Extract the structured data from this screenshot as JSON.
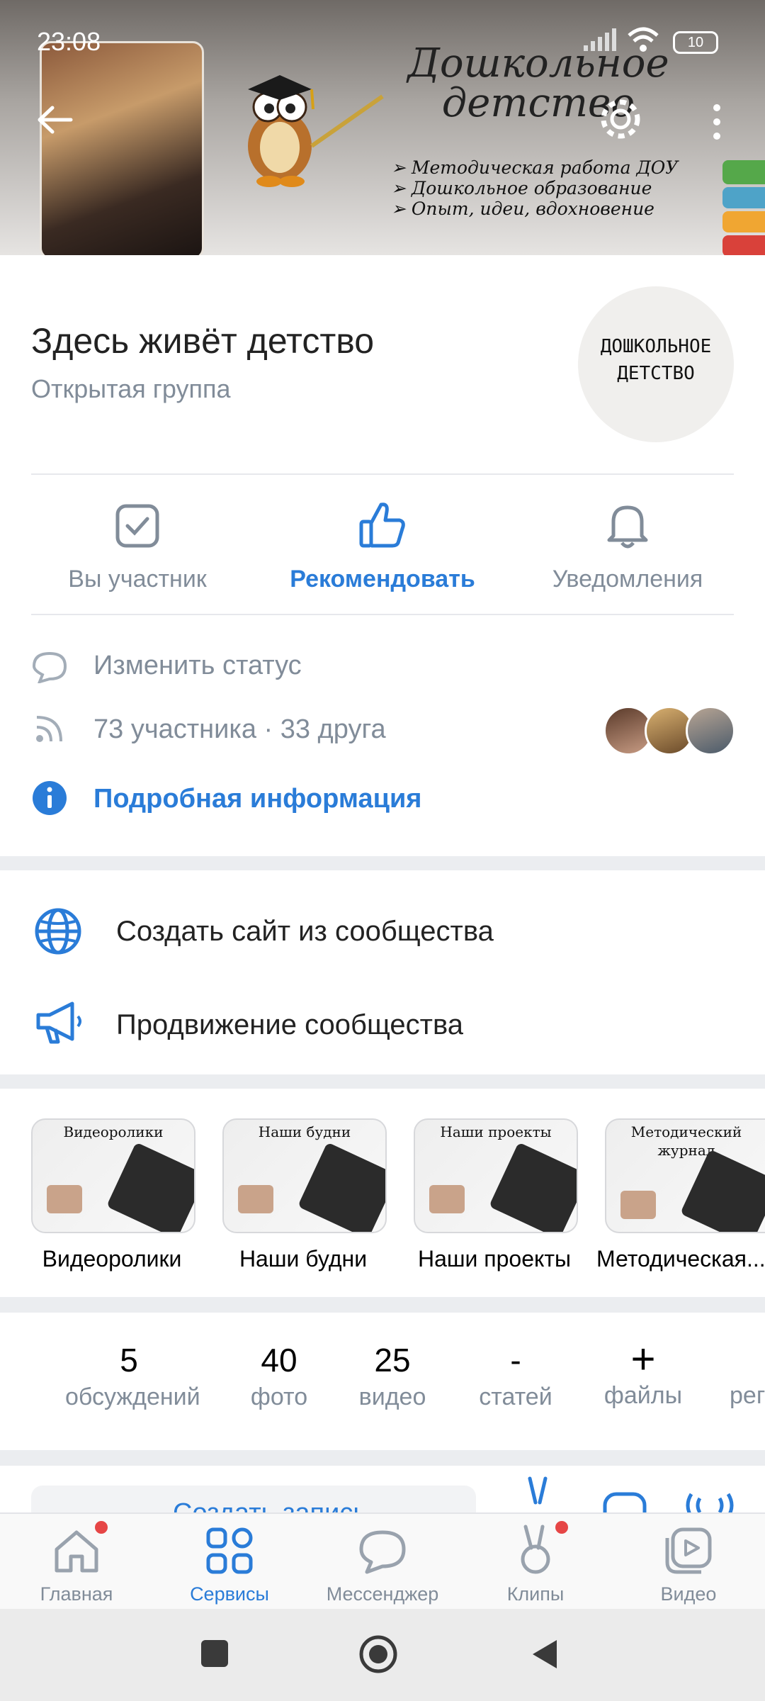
{
  "status_bar": {
    "time": "23:08",
    "battery": "10"
  },
  "cover": {
    "title_line1": "Дошкольное",
    "title_line2": "детство",
    "bullets": [
      "Методическая работа ДОУ",
      "Дошкольное образование",
      "Опыт, идеи, вдохновение"
    ],
    "back_icon": "arrow-left-icon",
    "settings_icon": "gear-icon",
    "more_icon": "more-vertical-icon"
  },
  "group": {
    "name": "Здесь живёт детство",
    "type": "Открытая группа",
    "avatar_text_line1": "ДОШКОЛЬНОЕ",
    "avatar_text_line2": "ДЕТСТВО"
  },
  "actions": [
    {
      "label": "Вы участник",
      "icon": "checkbox-icon",
      "active": false
    },
    {
      "label": "Рекомендовать",
      "icon": "thumbs-up-icon",
      "active": true
    },
    {
      "label": "Уведомления",
      "icon": "bell-icon",
      "active": false
    }
  ],
  "info": {
    "status": "Изменить статус",
    "members": "73 участника · 33 друга",
    "details": "Подробная информация"
  },
  "links": {
    "create_site": "Создать сайт из сообщества",
    "promote": "Продвижение сообщества"
  },
  "albums": [
    {
      "caption": "Видеоролики",
      "label": "Видеоролики"
    },
    {
      "caption": "Наши будни",
      "label": "Наши будни"
    },
    {
      "caption": "Наши проекты",
      "label": "Наши проекты"
    },
    {
      "caption": "Методический журнал",
      "label": "Методическая..."
    }
  ],
  "stats": [
    {
      "value": "5",
      "label": "обсуждений"
    },
    {
      "value": "40",
      "label": "фото"
    },
    {
      "value": "25",
      "label": "видео"
    },
    {
      "value": "-",
      "label": "статей"
    },
    {
      "value": "+",
      "label": "файлы"
    },
    {
      "value": "",
      "label": "рег"
    }
  ],
  "post": {
    "create_label": "Создать запись"
  },
  "bottom_nav": [
    {
      "label": "Главная",
      "icon": "home-icon",
      "badge": true,
      "active": false
    },
    {
      "label": "Сервисы",
      "icon": "services-grid-icon",
      "badge": false,
      "active": true
    },
    {
      "label": "Мессенджер",
      "icon": "chat-bubble-icon",
      "badge": false,
      "active": false
    },
    {
      "label": "Клипы",
      "icon": "clips-icon",
      "badge": true,
      "active": false
    },
    {
      "label": "Видео",
      "icon": "video-icon",
      "badge": false,
      "active": false
    }
  ],
  "colors": {
    "accent": "#2a7cd8",
    "secondary_text": "#818c99",
    "badge": "#e64646"
  }
}
